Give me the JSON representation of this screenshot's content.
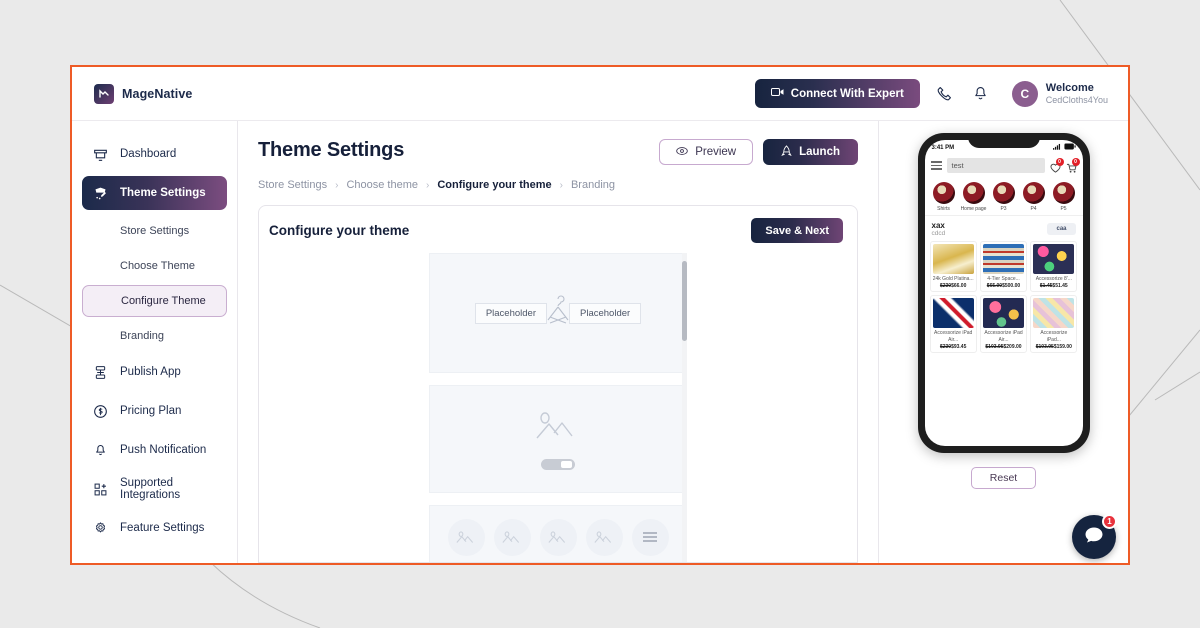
{
  "window": {
    "border_color": "#ee5b26",
    "background": "#eaeaea"
  },
  "topbar": {
    "brand_name": "MageNative",
    "expert_button": "Connect With Expert",
    "phone_icon": "phone-icon",
    "bell_icon": "bell-icon",
    "avatar_initial": "C",
    "welcome_label": "Welcome",
    "account_name": "CedCloths4You"
  },
  "sidebar": {
    "items": [
      {
        "label": "Dashboard",
        "icon": "dashboard-icon",
        "active": false
      },
      {
        "label": "Theme Settings",
        "icon": "theme-settings-icon",
        "active": true
      },
      {
        "label": "Publish App",
        "icon": "publish-app-icon",
        "active": false
      },
      {
        "label": "Pricing Plan",
        "icon": "pricing-plan-icon",
        "active": false
      },
      {
        "label": "Push Notification",
        "icon": "bell-icon",
        "active": false
      },
      {
        "label": "Supported Integrations",
        "icon": "integrations-icon",
        "active": false
      },
      {
        "label": "Feature Settings",
        "icon": "gear-icon",
        "active": false
      }
    ],
    "sub_items": [
      {
        "label": "Store Settings",
        "selected": false
      },
      {
        "label": "Choose Theme",
        "selected": false
      },
      {
        "label": "Configure Theme",
        "selected": true
      },
      {
        "label": "Branding",
        "selected": false
      }
    ]
  },
  "page": {
    "title": "Theme Settings",
    "preview_button": "Preview",
    "launch_button": "Launch",
    "breadcrumb": [
      {
        "label": "Store Settings",
        "current": false
      },
      {
        "label": "Choose theme",
        "current": false
      },
      {
        "label": "Configure your theme",
        "current": true
      },
      {
        "label": "Branding",
        "current": false
      }
    ],
    "breadcrumb_separator": "›"
  },
  "card": {
    "title": "Configure your theme",
    "save_button": "Save & Next",
    "hero_placeholder_left": "Placeholder",
    "hero_placeholder_right": "Placeholder",
    "image_block_icon": "image-placeholder-icon",
    "toggle_icon": "toggle-switch",
    "circle_icons": [
      "image-placeholder-icon",
      "image-placeholder-icon",
      "image-placeholder-icon",
      "image-placeholder-icon",
      "hamburger-menu-icon"
    ]
  },
  "preview": {
    "reset_button": "Reset",
    "chat_badge_count": "1",
    "chat_icon": "chat-bubble-icon",
    "phone": {
      "status_time": "3:41 PM",
      "signal_icon": "signal-icon",
      "battery_icon": "battery-icon",
      "menu_icon": "hamburger-menu-icon",
      "search_value": "test",
      "wishlist_badge": "0",
      "cart_badge": "0",
      "categories": [
        {
          "label": "Shirts"
        },
        {
          "label": "Home page"
        },
        {
          "label": "P3"
        },
        {
          "label": "P4"
        },
        {
          "label": "P5"
        }
      ],
      "section_title": "xax",
      "section_subtitle": "cdcd",
      "section_button": "caa",
      "products": [
        {
          "title": "24k Gold Platina...",
          "old_price": "$230",
          "price": "$66.00",
          "swatch": "gold"
        },
        {
          "title": "4-Tier Space...",
          "old_price": "$65.00",
          "price": "$500.00",
          "swatch": "shelf"
        },
        {
          "title": "Accessorize 8'...",
          "old_price": "$1.45",
          "price": "$51.45",
          "swatch": "floral"
        },
        {
          "title": "Accessorize iPad Air...",
          "old_price": "$230",
          "price": "$93.45",
          "swatch": "flag"
        },
        {
          "title": "Accessorize iPad Air...",
          "old_price": "$103.95",
          "price": "$209.00",
          "swatch": "floral2"
        },
        {
          "title": "Accessorize iPad...",
          "old_price": "$103.95",
          "price": "$159.00",
          "swatch": "pastel"
        }
      ]
    }
  }
}
